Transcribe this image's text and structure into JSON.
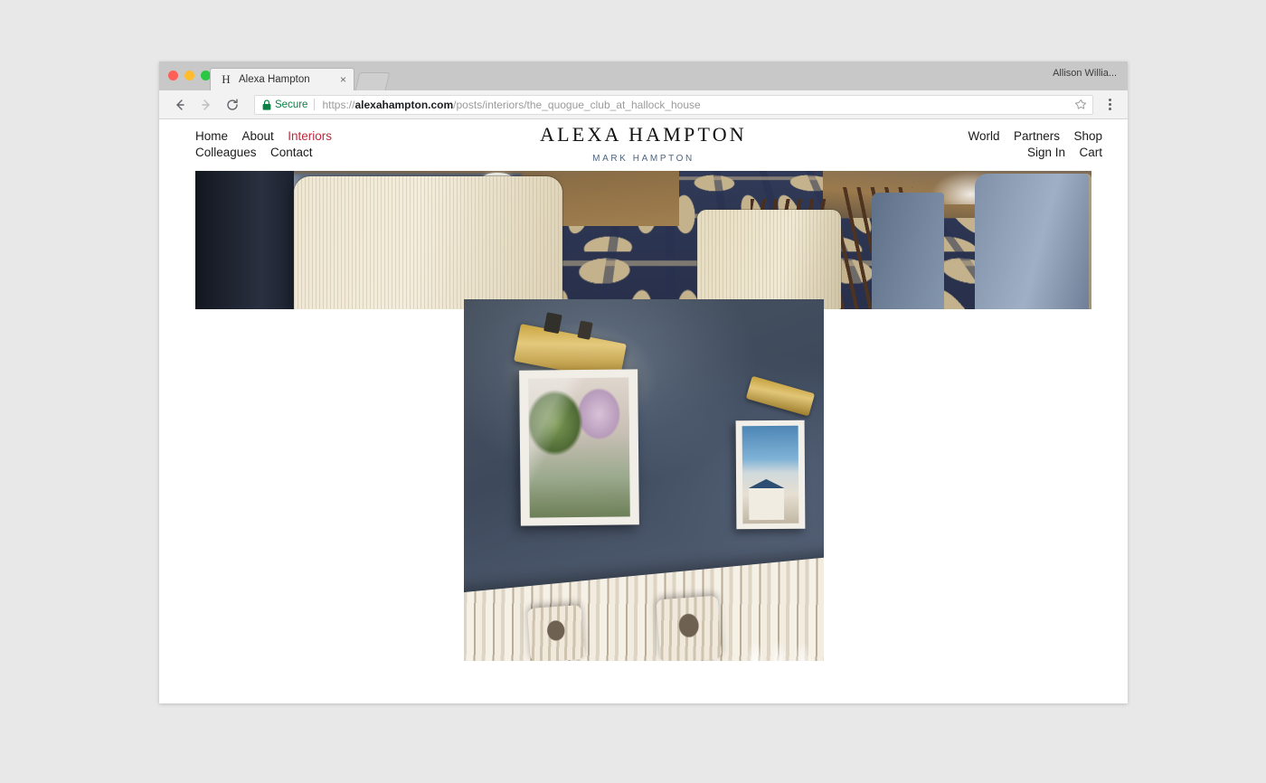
{
  "window": {
    "user_label": "Allison Willia...",
    "traffic_lights": [
      "close-button",
      "minimize-button",
      "maximize-button"
    ]
  },
  "tab": {
    "favicon_letter": "H",
    "title": "Alexa Hampton",
    "close_label": "×",
    "new_tab_label": ""
  },
  "toolbar": {
    "back_label": "",
    "forward_label": "",
    "reload_label": "",
    "security_label": "Secure",
    "url_scheme": "https://",
    "url_host": "alexahampton.com",
    "url_path": "/posts/interiors/the_quogue_club_at_hallock_house",
    "bookmark_label": "",
    "menu_label": ""
  },
  "site": {
    "brand": {
      "title": "ALEXA HAMPTON",
      "subtitle": "MARK HAMPTON"
    },
    "nav_left_row1": [
      {
        "label": "Home",
        "active": false
      },
      {
        "label": "About",
        "active": false
      },
      {
        "label": "Interiors",
        "active": true
      }
    ],
    "nav_left_row2": [
      {
        "label": "Colleagues",
        "active": false
      },
      {
        "label": "Contact",
        "active": false
      }
    ],
    "nav_right_row1": [
      {
        "label": "World"
      },
      {
        "label": "Partners"
      },
      {
        "label": "Shop"
      }
    ],
    "nav_right_row2": [
      {
        "label": "Sign In"
      },
      {
        "label": "Cart"
      }
    ],
    "images": [
      {
        "name": "hero-dining-room-photo",
        "alt": "Dining room with cream upholstered chairs, wood tables and navy geometric patterned carpet"
      },
      {
        "name": "interior-wall-photo",
        "alt": "Slate blue wall with brass picture lights, framed artwork and a striped banquette with patterned pillows"
      }
    ]
  },
  "colors": {
    "accent_red": "#c0283c",
    "brand_subtitle_blue": "#4f6580",
    "secure_green": "#0b8043",
    "page_background": "#e8e8e8",
    "titlebar_gray": "#c8c8c8"
  }
}
